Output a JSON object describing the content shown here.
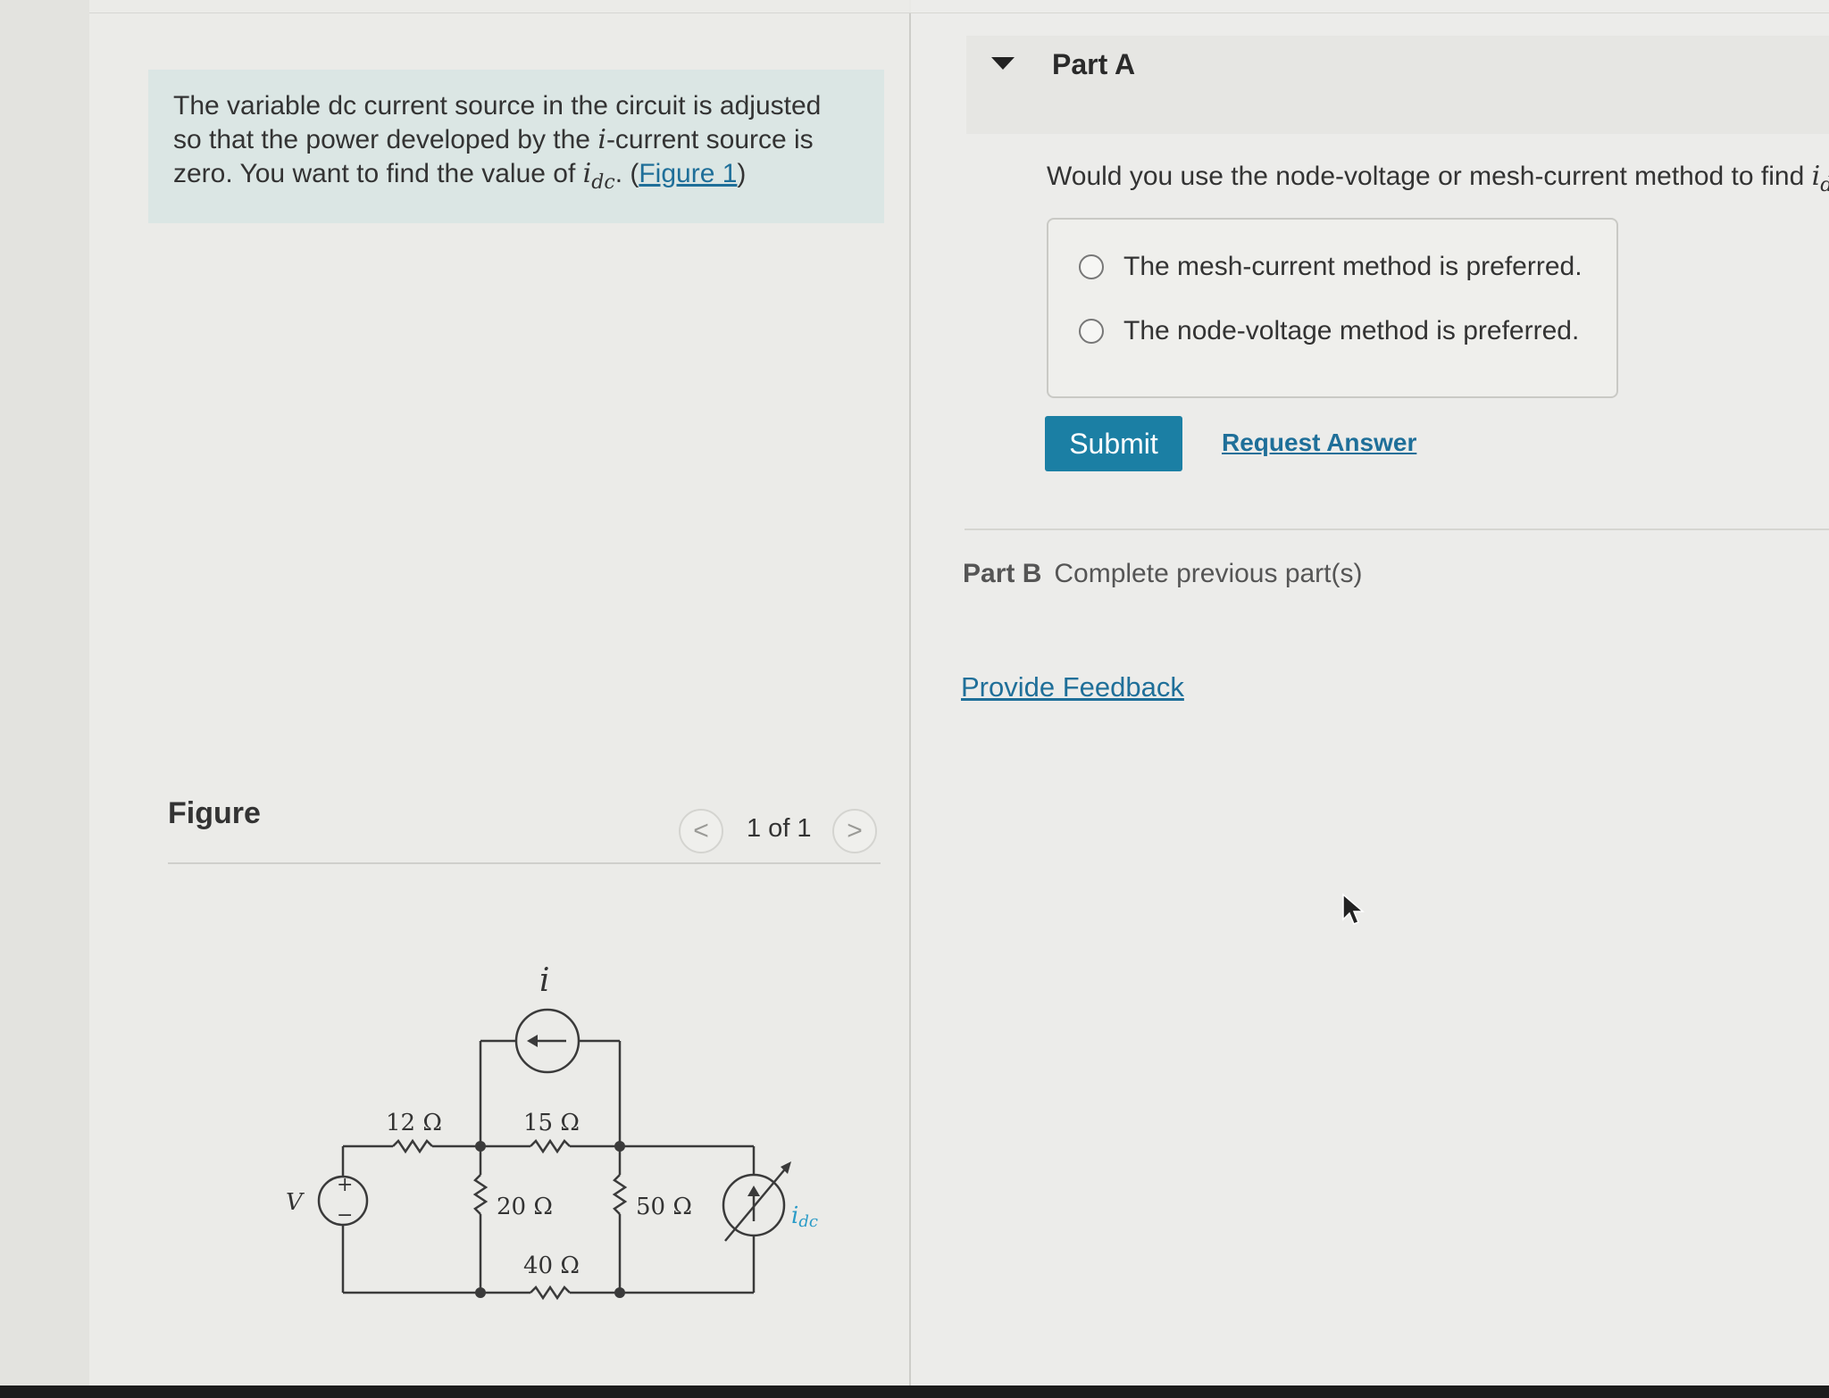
{
  "problem": {
    "line1": "The variable dc current source in the circuit is adjusted",
    "line2_pre": "so that the power developed by the ",
    "line2_var": "i",
    "line2_post": "-current source is",
    "line3_pre": "zero. You want to find the value of ",
    "line3_var": "i",
    "line3_sub": "dc",
    "line3_dot": ". (",
    "figure_link": "Figure 1",
    "line3_end": ")"
  },
  "figure": {
    "title": "Figure",
    "prev_label": "<",
    "next_label": ">",
    "count": "1 of 1"
  },
  "circuit": {
    "source_label": "V",
    "plus": "+",
    "minus": "−",
    "i_label": "i",
    "r1": "12 Ω",
    "r2": "15 Ω",
    "r3": "20 Ω",
    "r4": "50 Ω",
    "r5": "40 Ω",
    "idc_label": "i",
    "idc_sub": "dc"
  },
  "partA": {
    "title": "Part A",
    "question_pre": "Would you use the node-voltage or mesh-current method to find ",
    "question_var": "i",
    "question_sub": "dc",
    "options": [
      "The mesh-current method is preferred.",
      "The node-voltage method is preferred."
    ],
    "submit": "Submit",
    "request_answer": "Request Answer"
  },
  "partB": {
    "label": "Part B",
    "status": "Complete previous part(s)"
  },
  "feedback": "Provide Feedback",
  "colors": {
    "accent": "#1b7fa4",
    "link": "#1f6f99",
    "circuit_label": "#2a9bc7"
  }
}
